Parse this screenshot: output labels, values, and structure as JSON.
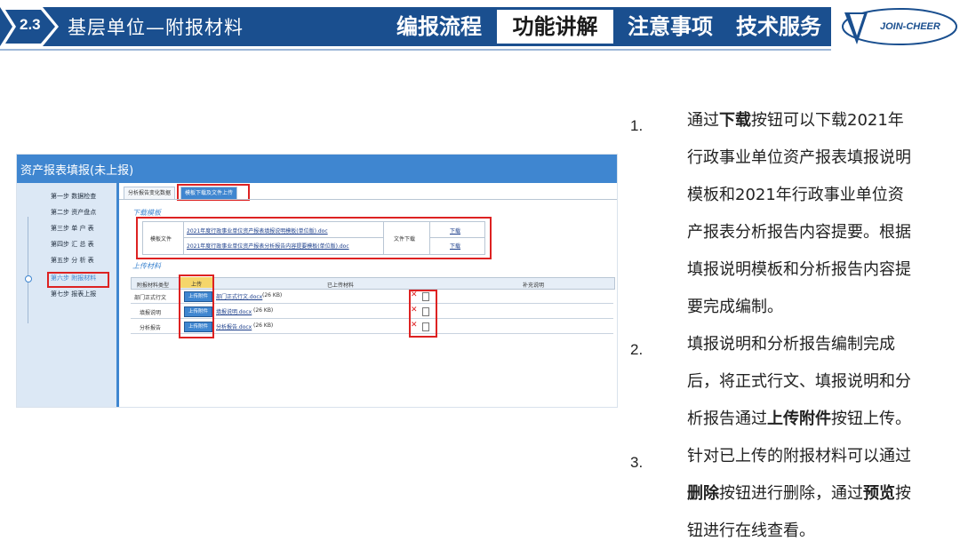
{
  "header": {
    "section_number": "2.3",
    "section_title": "基层单位—附报材料",
    "nav_tabs": [
      {
        "label": "编报流程",
        "active": false
      },
      {
        "label": "功能讲解",
        "active": true
      },
      {
        "label": "注意事项",
        "active": false
      },
      {
        "label": "技术服务",
        "active": false
      }
    ],
    "logo_text": "JOIN-CHEER",
    "brand_color": "#1a4f8f"
  },
  "app": {
    "title": "资产报表填报(未上报)",
    "steps": [
      {
        "label": "第一步 数据检查",
        "active": false
      },
      {
        "label": "第二步 资产盘点",
        "active": false
      },
      {
        "label": "第三步 单 户 表",
        "active": false
      },
      {
        "label": "第四步 汇 总 表",
        "active": false
      },
      {
        "label": "第五步 分 析 表",
        "active": false
      },
      {
        "label": "第六步 附报材料",
        "active": true
      },
      {
        "label": "第七步 报表上报",
        "active": false
      }
    ],
    "tabs": [
      {
        "label": "分析报告变化数据",
        "active": false
      },
      {
        "label": "模板下载及文件上传",
        "active": true
      }
    ],
    "download_section": {
      "label": "下载模板",
      "row_label": "模板文件",
      "files": [
        "2021年度行政事业单位资产报表填报说明模板(单位版).doc",
        "2021年度行政事业单位资产报表分析报告内容提要模板(单位版).doc"
      ],
      "col_label": "文件下载",
      "download_links": [
        "下载",
        "下载"
      ]
    },
    "upload_section": {
      "label": "上传材料",
      "headers": [
        "附报材料类型",
        "上传",
        "已上传材料",
        "补充说明"
      ],
      "rows": [
        {
          "type": "部门正式行文",
          "button": "上传附件",
          "file": "部门正式行文.docx",
          "size": "(26 KB)"
        },
        {
          "type": "填报说明",
          "button": "上传附件",
          "file": "填报说明.docx",
          "size": "(26 KB)"
        },
        {
          "type": "分析报告",
          "button": "上传附件",
          "file": "分析报告.docx",
          "size": "(26 KB)"
        }
      ],
      "delete_icon": "close-icon",
      "preview_icon": "document-icon"
    }
  },
  "instructions": [
    {
      "number": "1.",
      "lines": [
        [
          "通过",
          "下载",
          "按钮可以下载2021年"
        ],
        [
          "行政事业单位资产报表填报说明"
        ],
        [
          "模板和2021年行政事业单位资"
        ],
        [
          "产报表分析报告内容提要。根据"
        ],
        [
          "填报说明模板和分析报告内容提"
        ],
        [
          "要完成编制。"
        ]
      ]
    },
    {
      "number": "2.",
      "lines": [
        [
          "填报说明和分析报告编制完成"
        ],
        [
          "后，将正式行文、填报说明和分"
        ],
        [
          "析报告通过",
          "上传附件",
          "按钮上传。"
        ]
      ]
    },
    {
      "number": "3.",
      "lines": [
        [
          "针对已上传的附报材料可以通过"
        ],
        [
          "",
          "删除",
          "按钮进行删除，通过",
          "预览",
          "按"
        ],
        [
          "钮进行在线查看。"
        ]
      ]
    }
  ]
}
